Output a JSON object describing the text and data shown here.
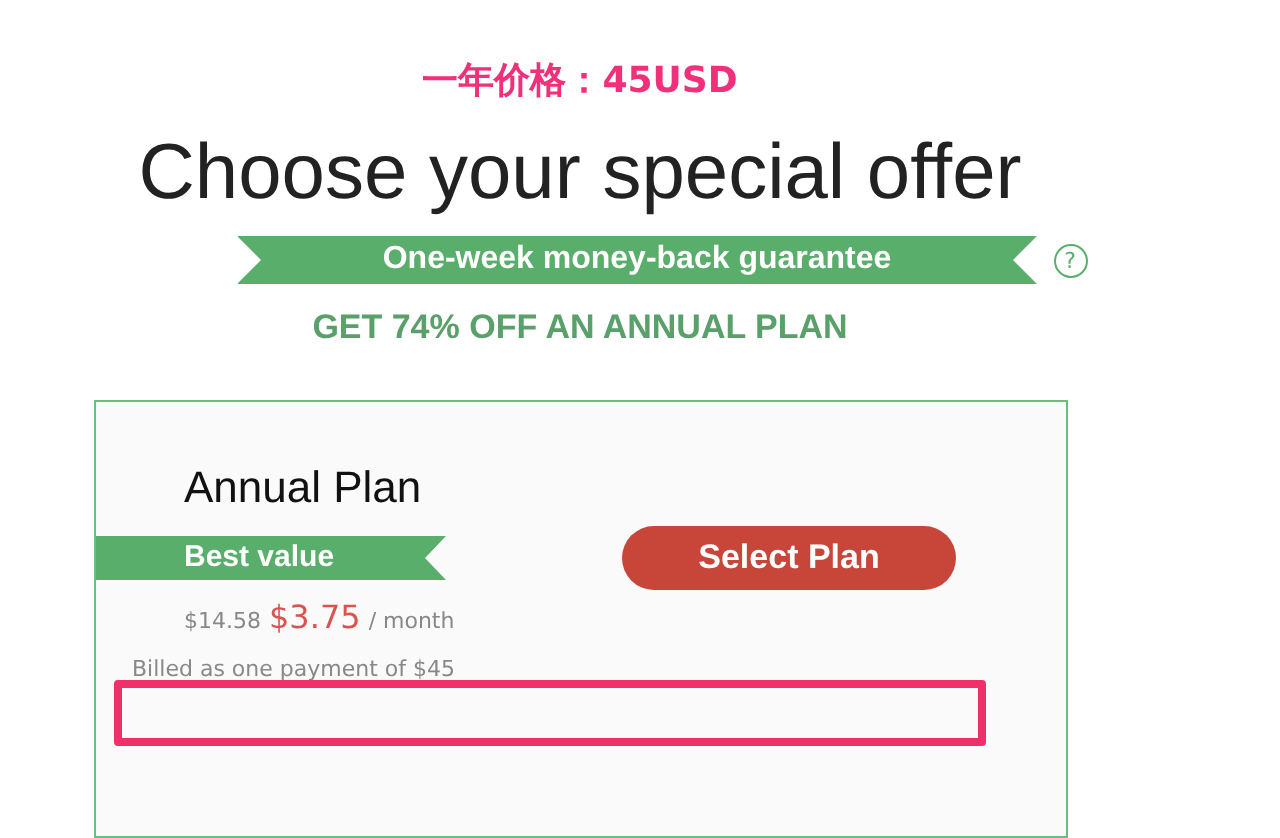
{
  "annotation": "一年价格：45USD",
  "heading": "Choose your special offer",
  "guarantee": {
    "text": "One-week money-back guarantee",
    "help": "?"
  },
  "promo": "GET 74% OFF AN ANNUAL PLAN",
  "plan": {
    "name": "Annual Plan",
    "badge": "Best value",
    "button": "Select Plan",
    "old_price": "$14.58",
    "price": "$3.75",
    "period": "/ month",
    "billing": "Billed as one payment of $45"
  }
}
